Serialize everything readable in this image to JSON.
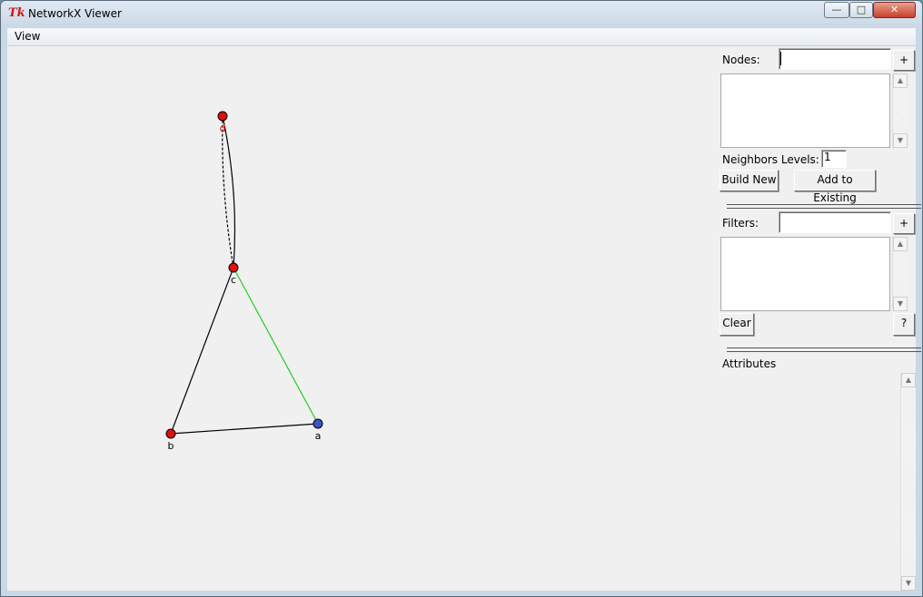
{
  "window": {
    "title": "NetworkX Viewer",
    "icon": "tk-feather-icon",
    "controls": {
      "minimize": "—",
      "maximize": "□",
      "close": "✕"
    }
  },
  "menu": {
    "view": "View"
  },
  "graph": {
    "nodes": [
      {
        "id": "a",
        "label": "a",
        "fill": "#3b55c8",
        "label_color": "#000000"
      },
      {
        "id": "b",
        "label": "b",
        "fill": "#e01010",
        "label_color": "#000000"
      },
      {
        "id": "c",
        "label": "c",
        "fill": "#e01010",
        "label_color": "#000000"
      },
      {
        "id": "d",
        "label": "d",
        "fill": "#e01010",
        "label_color": "#e01010"
      }
    ],
    "edges": [
      {
        "from": "c",
        "to": "d",
        "style": "solid",
        "color": "#000000"
      },
      {
        "from": "c",
        "to": "d",
        "style": "dashed",
        "color": "#000000"
      },
      {
        "from": "c",
        "to": "b",
        "style": "solid",
        "color": "#000000"
      },
      {
        "from": "c",
        "to": "a",
        "style": "solid",
        "color": "#22cc22"
      },
      {
        "from": "b",
        "to": "a",
        "style": "solid",
        "color": "#000000"
      }
    ]
  },
  "sidebar": {
    "nodes_label": "Nodes:",
    "nodes_value": "",
    "add_node_button": "+",
    "neighbors_label": "Neighbors Levels:",
    "neighbors_value": "1",
    "build_new_button": "Build New",
    "add_existing_button": "Add to Existing",
    "filters_label": "Filters:",
    "filters_value": "",
    "add_filter_button": "+",
    "clear_button": "Clear",
    "help_button": "?",
    "attributes_label": "Attributes"
  }
}
